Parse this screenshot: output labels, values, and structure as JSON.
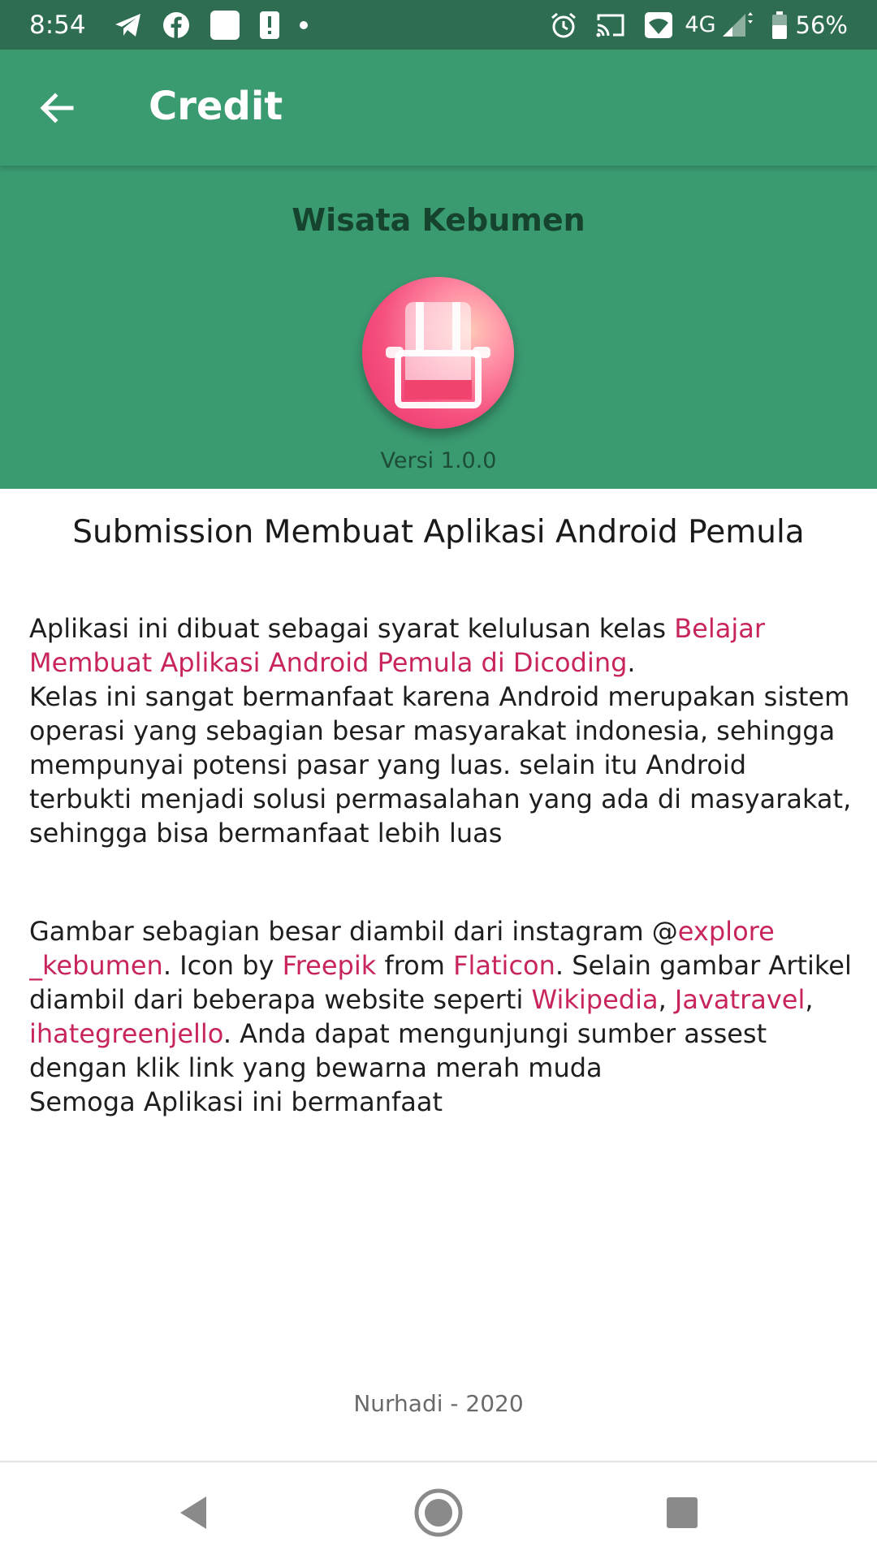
{
  "status_bar": {
    "time": "8:54",
    "network": "4G",
    "battery": "56%",
    "icons_left": [
      "telegram-icon",
      "facebook-icon",
      "square-notification-icon",
      "alert-icon",
      "dot-icon"
    ],
    "icons_right": [
      "alarm-icon",
      "cast-icon",
      "wifi-icon",
      "signal-icon",
      "battery-icon"
    ]
  },
  "app_bar": {
    "title": "Credit",
    "back_icon": "arrow-back-icon",
    "background": "#3a9a70"
  },
  "header": {
    "app_name": "Wisata Kebumen",
    "logo_icon": "chair-logo-icon",
    "version": "Versi 1.0.0"
  },
  "content": {
    "submission_title": "Submission Membuat Aplikasi Android Pemula",
    "para1": {
      "l1_a": "Aplikasi ini dibuat sebagai syarat kelulusan kelas ",
      "l1_link": "Belajar",
      "l2_link": "Membuat Aplikasi Android Pemula di Dicoding",
      "l2_b": ".",
      "l3": "Kelas ini sangat bermanfaat karena Android merupakan sistem",
      "l4": "operasi yang sebagian besar masyarakat indonesia, sehingga",
      "l5": "mempunyai potensi pasar yang luas. selain itu Android",
      "l6": "terbukti menjadi solusi permasalahan yang ada di masyarakat,",
      "l7": "sehingga bisa bermanfaat lebih luas"
    },
    "para2": {
      "l1_a": "Gambar sebagian besar diambil dari instagram @",
      "l1_link": "explore",
      "l2_link1": "_kebumen",
      "l2_b": ". Icon by ",
      "l2_link2": "Freepik",
      "l2_c": " from ",
      "l2_link3": "Flaticon",
      "l2_d": ". Selain gambar Artikel",
      "l3_a": "diambil dari beberapa website seperti ",
      "l3_link1": "Wikipedia",
      "l3_b": ", ",
      "l3_link2": "Javatravel",
      "l3_c": ",",
      "l4_link": "ihategreenjello",
      "l4_b": ". Anda dapat mengunjungi sumber assest",
      "l5": "dengan klik link yang bewarna merah muda",
      "l6": "Semoga Aplikasi ini bermanfaat"
    },
    "footer": "Nurhadi - 2020",
    "link_color": "#c8245e"
  },
  "nav_bar": {
    "icons": [
      "nav-back-icon",
      "nav-home-icon",
      "nav-recents-icon"
    ]
  }
}
